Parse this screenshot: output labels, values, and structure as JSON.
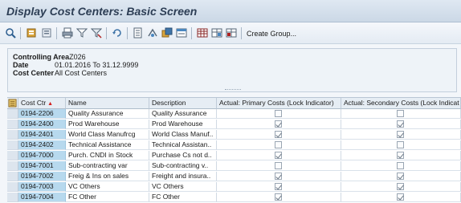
{
  "window": {
    "title": "Display Cost Centers: Basic Screen"
  },
  "toolbar": {
    "icons": [
      "select-icon",
      "first-page-icon",
      "last-page-icon",
      "print-icon",
      "filter-icon",
      "set-filter-icon",
      "refresh-icon",
      "export-icon",
      "sort-icon",
      "copy-icon",
      "details-icon",
      "table-icon",
      "insert-row-icon",
      "delete-row-icon"
    ],
    "create_group_label": "Create Group..."
  },
  "header": {
    "controlling_area_label": "Controlling Area",
    "controlling_area_value": "Z026",
    "date_label": "Date",
    "date_value": "01.01.2016 To 31.12.9999",
    "cost_center_label": "Cost Center",
    "cost_center_value": "All Cost Centers"
  },
  "table": {
    "columns": [
      "Cost Ctr",
      "Name",
      "Description",
      "Actual: Primary Costs (Lock Indicator)",
      "Actual: Secondary Costs (Lock Indicat"
    ],
    "rows": [
      {
        "cost_ctr": "0194-2206",
        "name": "Quality Assurance",
        "description": "Quality Assurance",
        "primary_lock": false,
        "secondary_lock": false
      },
      {
        "cost_ctr": "0194-2400",
        "name": "Prod Warehouse",
        "description": "Prod Warehouse",
        "primary_lock": true,
        "secondary_lock": true
      },
      {
        "cost_ctr": "0194-2401",
        "name": "World Class Manufrcg",
        "description": "World Class Manuf..",
        "primary_lock": true,
        "secondary_lock": true
      },
      {
        "cost_ctr": "0194-2402",
        "name": "Technical Assistance",
        "description": "Technical Assistan..",
        "primary_lock": false,
        "secondary_lock": false
      },
      {
        "cost_ctr": "0194-7000",
        "name": "Purch. CNDI in Stock",
        "description": "Purchase Cs not d..",
        "primary_lock": true,
        "secondary_lock": true
      },
      {
        "cost_ctr": "0194-7001",
        "name": "Sub-contracting var",
        "description": "Sub-contracting v..",
        "primary_lock": false,
        "secondary_lock": false
      },
      {
        "cost_ctr": "0194-7002",
        "name": "Freig & Ins on sales",
        "description": "Freight and insura..",
        "primary_lock": true,
        "secondary_lock": true
      },
      {
        "cost_ctr": "0194-7003",
        "name": "VC Others",
        "description": "VC Others",
        "primary_lock": true,
        "secondary_lock": true
      },
      {
        "cost_ctr": "0194-7004",
        "name": "FC Other",
        "description": "FC Other",
        "primary_lock": true,
        "secondary_lock": true
      }
    ]
  },
  "colors": {
    "key_cell": "#b7d9ee",
    "title_text": "#2d3e55",
    "sort_indicator": "#d21f1f"
  }
}
